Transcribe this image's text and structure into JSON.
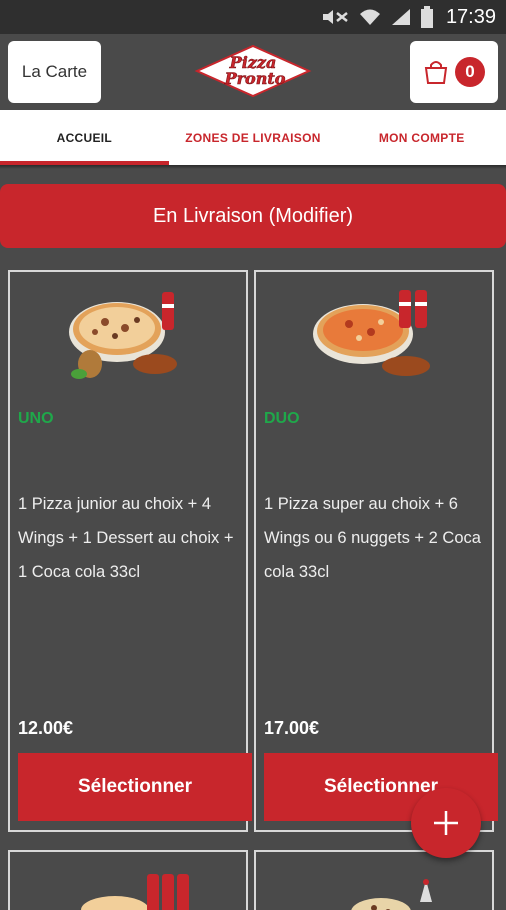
{
  "status_bar": {
    "time": "17:39",
    "icons": [
      "mute-icon",
      "wifi-icon",
      "signal-icon",
      "battery-icon"
    ]
  },
  "header": {
    "menu_label": "La Carte",
    "logo_text": [
      "Pizza",
      "Pronto"
    ],
    "cart_count": "0"
  },
  "tabs": [
    {
      "label": "ACCUEIL",
      "active": true
    },
    {
      "label": "ZONES DE LIVRAISON",
      "active": false
    },
    {
      "label": "MON COMPTE",
      "active": false
    }
  ],
  "delivery": {
    "label": "En Livraison (Modifier)"
  },
  "products": [
    {
      "name": "UNO",
      "description": "1 Pizza junior au choix + 4 Wings + 1 Dessert au choix + 1 Coca cola 33cl",
      "price": "12.00€",
      "button": "Sélectionner"
    },
    {
      "name": "DUO",
      "description": "1 Pizza super au choix + 6 Wings ou 6 nuggets + 2 Coca cola 33cl",
      "price": "17.00€",
      "button": "Sélectionner"
    }
  ],
  "colors": {
    "brand_red": "#c8262c",
    "product_green": "#1fa84a",
    "background": "#4a4a4a"
  }
}
